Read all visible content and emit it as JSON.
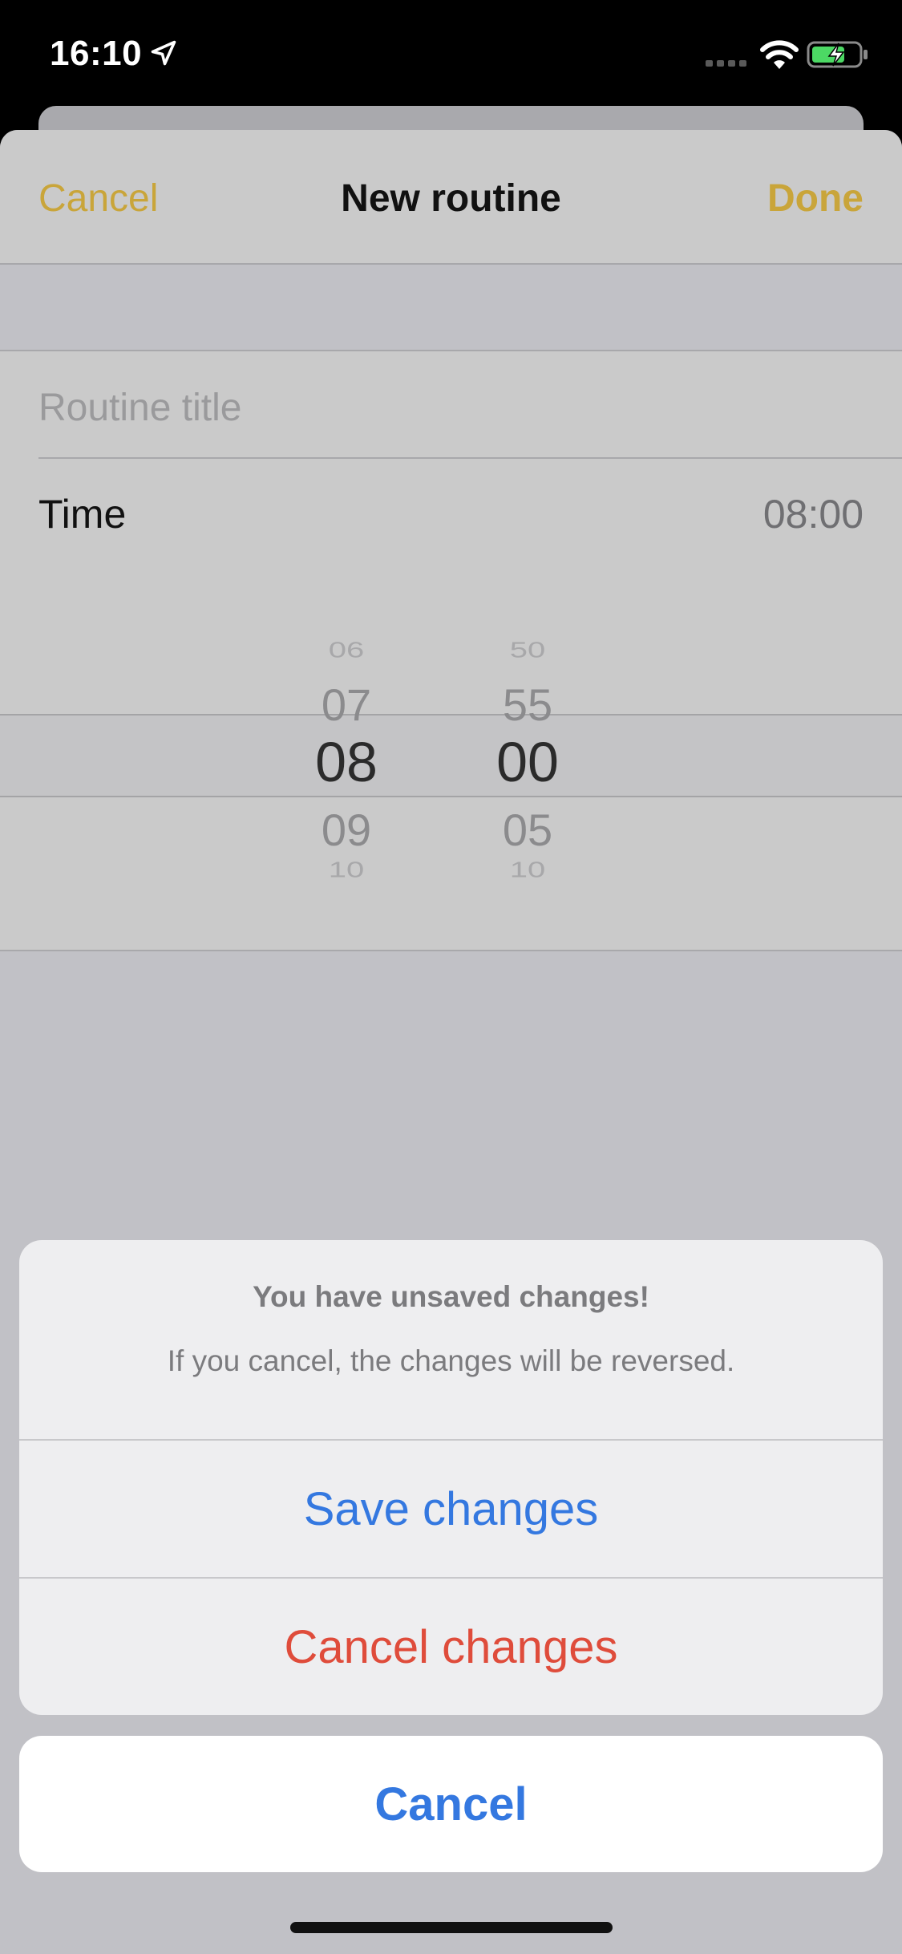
{
  "status_bar": {
    "time": "16:10",
    "icons": [
      "location-arrow-icon",
      "signal-icon",
      "wifi-icon",
      "battery-charging-icon"
    ]
  },
  "nav": {
    "cancel_label": "Cancel",
    "title": "New routine",
    "done_label": "Done"
  },
  "form": {
    "title_placeholder": "Routine title",
    "time_label": "Time",
    "time_value": "08:00"
  },
  "picker": {
    "hours": [
      "06",
      "07",
      "08",
      "09",
      "10"
    ],
    "minutes": [
      "50",
      "55",
      "00",
      "05",
      "10"
    ]
  },
  "action_sheet": {
    "title": "You have unsaved changes!",
    "message": "If you cancel, the changes will be reversed.",
    "save_label": "Save changes",
    "cancel_changes_label": "Cancel changes",
    "cancel_label": "Cancel"
  },
  "colors": {
    "accent_gold": "#c9a53a",
    "action_blue": "#3478e0",
    "destructive_red": "#df4c3b"
  }
}
